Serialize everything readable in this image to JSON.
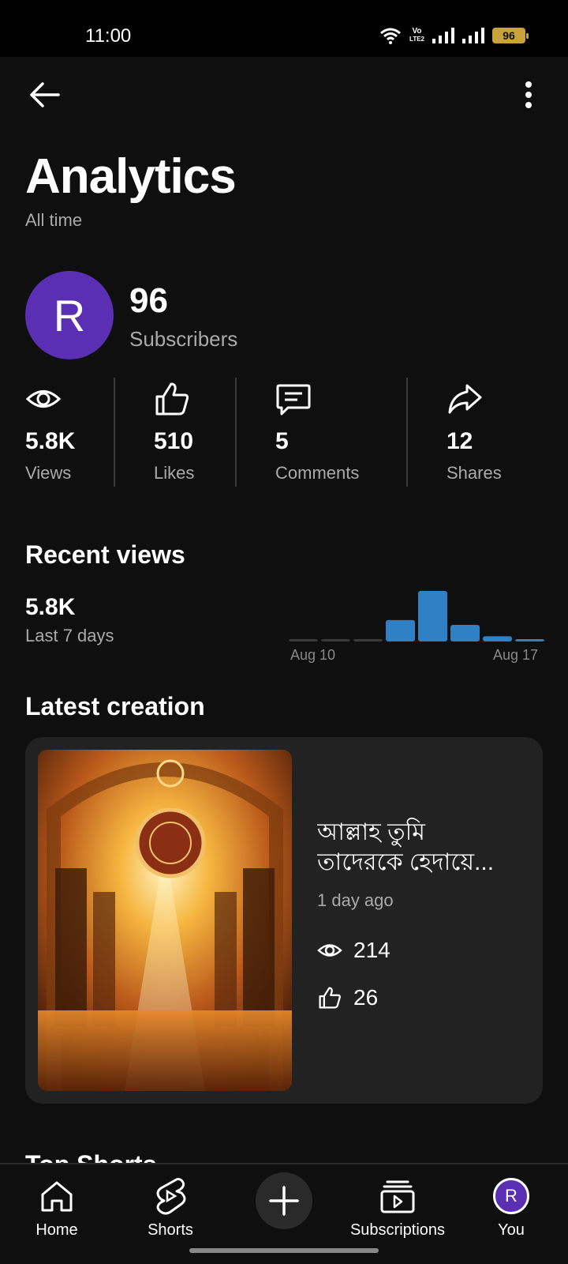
{
  "status_bar": {
    "time": "11:00",
    "battery": "96",
    "volte_top": "Vo",
    "volte_bottom": "LTE2",
    "icons": [
      "wifi-icon",
      "volte-icon",
      "signal-icon",
      "signal-icon",
      "battery-icon"
    ]
  },
  "header": {
    "back_icon": "arrow-left-icon",
    "more_icon": "more-vertical-icon",
    "title": "Analytics",
    "subtitle": "All time"
  },
  "channel": {
    "avatar_letter": "R",
    "avatar_color": "#5b2fb4",
    "subscribers": "96",
    "subscribers_label": "Subscribers"
  },
  "stats": [
    {
      "icon": "eye-icon",
      "value": "5.8K",
      "label": "Views"
    },
    {
      "icon": "thumbs-up-icon",
      "value": "510",
      "label": "Likes"
    },
    {
      "icon": "comment-icon",
      "value": "5",
      "label": "Comments"
    },
    {
      "icon": "share-icon",
      "value": "12",
      "label": "Shares"
    }
  ],
  "recent_views": {
    "title": "Recent views",
    "value": "5.8K",
    "period": "Last 7 days",
    "x_start": "Aug 10",
    "x_end": "Aug 17"
  },
  "chart_data": {
    "type": "bar",
    "categories": [
      "",
      "",
      "",
      "",
      "",
      "",
      "",
      ""
    ],
    "values": [
      0,
      0,
      0,
      1550,
      3650,
      1200,
      380,
      150
    ],
    "colors": {
      "active": "#2f80c4",
      "zero": "#3a3a3a"
    },
    "xlabel": "",
    "ylabel": "",
    "x_tick_labels": [
      "Aug 10",
      "Aug 17"
    ]
  },
  "latest_creation": {
    "title": "Latest creation",
    "video_title_line1": "আল্লাহ তুমি",
    "video_title_line2": "তাদেরকে হেদায়ে...",
    "age": "1 day ago",
    "views": "214",
    "likes": "26"
  },
  "next_section": {
    "title": "Top Shorts"
  },
  "bottom_nav": {
    "home": "Home",
    "shorts": "Shorts",
    "create_icon": "plus-icon",
    "subscriptions": "Subscriptions",
    "you": "You",
    "you_avatar_letter": "R"
  }
}
